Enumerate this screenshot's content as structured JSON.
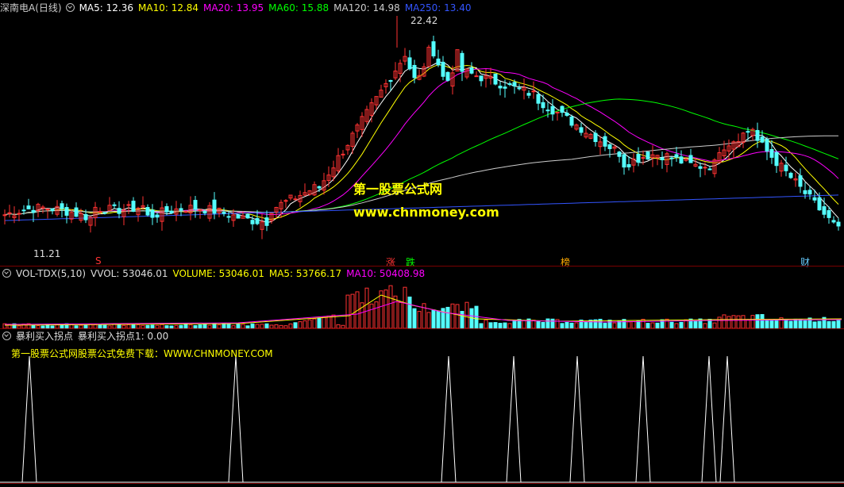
{
  "main": {
    "stock_title": "深南电A(日线)",
    "ma": [
      {
        "label": "MA5: 12.36",
        "color": "#ffffff"
      },
      {
        "label": "MA10: 12.84",
        "color": "#ffff00"
      },
      {
        "label": "MA20: 13.95",
        "color": "#ff00ff"
      },
      {
        "label": "MA60: 15.88",
        "color": "#00ff00"
      },
      {
        "label": "MA120: 14.98",
        "color": "#cccccc"
      },
      {
        "label": "MA250: 13.40",
        "color": "#3355ff"
      }
    ],
    "high_label": "22.42",
    "low_label": "11.21",
    "watermark_title": "第一股票公式网",
    "watermark_url": "www.chnmoney.com",
    "events": [
      {
        "text": "S",
        "color": "#ff3333"
      },
      {
        "text": "涨",
        "color": "#ff3333"
      },
      {
        "text": "跌",
        "color": "#00ff00"
      },
      {
        "text": "榜",
        "color": "#ffaa00"
      },
      {
        "text": "财",
        "color": "#66ccff"
      }
    ]
  },
  "volume": {
    "indicator": "VOL-TDX(5,10)",
    "vvol": "VVOL: 53046.01",
    "volume": "VOLUME: 53046.01",
    "ma5": "MA5: 53766.17",
    "ma10": "MA10: 50408.98",
    "colors": {
      "indicator": "#dddddd",
      "vvol": "#dddddd",
      "volume": "#ffff00",
      "ma5": "#ffff00",
      "ma10": "#ff00ff"
    }
  },
  "signal": {
    "indicator": "暴利买入拐点",
    "value": "暴利买入拐点1: 0.00",
    "note": "第一股票公式网股票公式免费下载：WWW.CHNMONEY.COM"
  },
  "colors": {
    "up": "#ff3232",
    "down": "#54ffff",
    "grid": "#7a0000"
  },
  "chart_data": {
    "type": "candlestick",
    "y_range": [
      11.21,
      22.42
    ],
    "signal_peaks_count": 8
  }
}
